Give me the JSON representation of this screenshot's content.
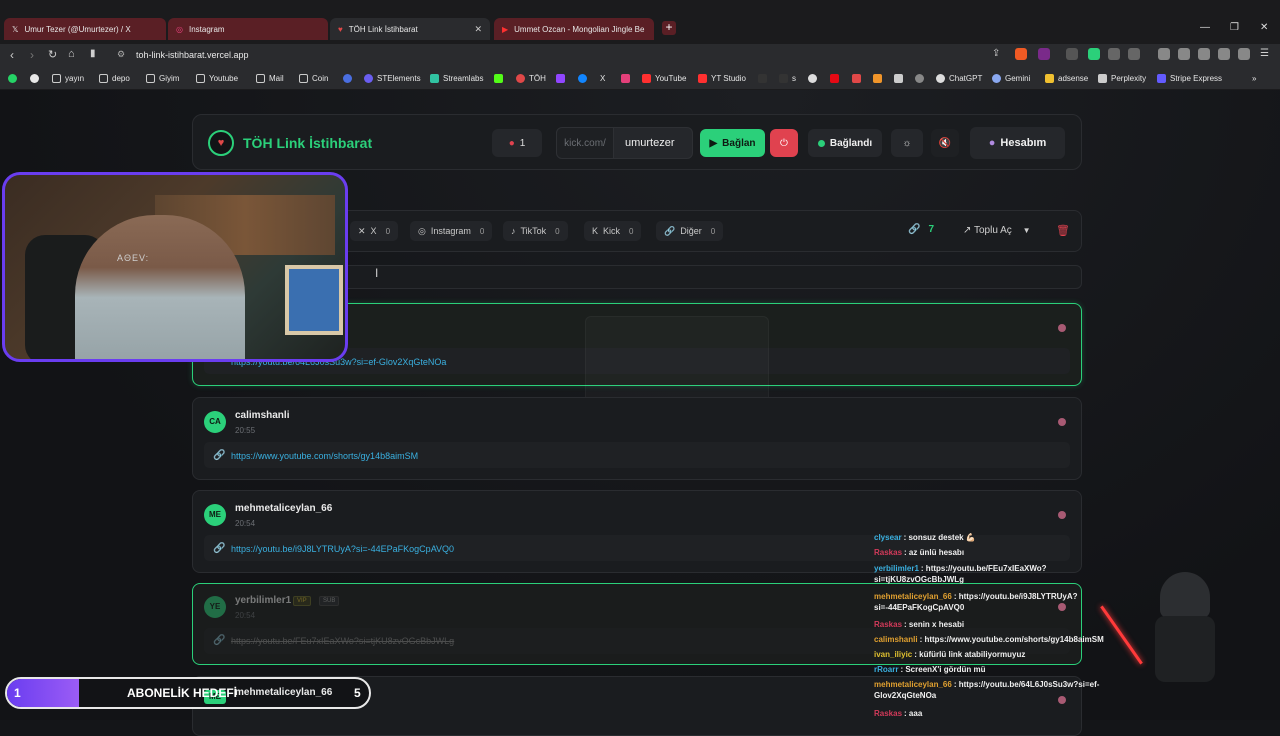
{
  "browser": {
    "tabs": [
      {
        "title": "Umur Tezer (@Umurtezer) / X",
        "icon": "x-icon"
      },
      {
        "title": "Instagram",
        "icon": "instagram-icon"
      },
      {
        "title": "TÖH Link İstihbarat",
        "icon": "toh-icon"
      },
      {
        "title": "Ummet Ozcan - Mongolian Jingle Be",
        "icon": "youtube-icon"
      }
    ],
    "url": "toh-link-istihbarat.vercel.app",
    "bookmarks": [
      "yayın",
      "depo",
      "Giyim",
      "Youtube",
      "Mail",
      "Coin",
      "STElements",
      "Streamlabs",
      "TÖH",
      "X",
      "YouTube",
      "YT Studio",
      "s",
      "ChatGPT",
      "Gemini",
      "adsense",
      "Perplexity",
      "Stripe Express"
    ]
  },
  "header": {
    "title": "TÖH Link İstihbarat",
    "channel_count": "1",
    "kick_prefix": "kick.com/",
    "kick_username": "umurtezer",
    "connect_label": "Bağlan",
    "status_label": "Bağlandı",
    "account_label": "Hesabım"
  },
  "filters": {
    "chips": [
      {
        "label": "X",
        "count": "0"
      },
      {
        "label": "Instagram",
        "count": "0"
      },
      {
        "label": "TikTok",
        "count": "0"
      },
      {
        "label": "Kick",
        "count": "0"
      },
      {
        "label": "Diğer",
        "count": "0"
      }
    ],
    "link_count": "7",
    "bulk_open_label": "Toplu Aç"
  },
  "links": [
    {
      "user": "",
      "initials": "",
      "time": "",
      "url": "https://youtu.be/64L6J0sSu3w?si=ef-Glov2XqGteNOa"
    },
    {
      "user": "calimshanli",
      "initials": "CA",
      "time": "20:55",
      "url": "https://www.youtube.com/shorts/gy14b8aimSM"
    },
    {
      "user": "mehmetaliceylan_66",
      "initials": "ME",
      "time": "20:54",
      "url": "https://youtu.be/i9J8LYTRUyA?si=-44EPaFKogCpAVQ0"
    },
    {
      "user": "yerbilimler1",
      "initials": "YE",
      "time": "20:54",
      "url": "https://youtu.be/FEu7xIEaXWo?si=tjKU8zvOGcBbJWLg",
      "badges": [
        "VIP",
        "SUB"
      ]
    },
    {
      "user": "mehmetaliceylan_66",
      "initials": "ME"
    }
  ],
  "webcam": {
    "shirt_text": "AΘEV:"
  },
  "goal": {
    "start": "1",
    "label": "ABONELİK HEDEFİ",
    "end": "5",
    "progress": 0.2
  },
  "chat": [
    {
      "user": "clysear",
      "color": "#3ab0e0",
      "msg": ": sonsuz destek 💪🏻"
    },
    {
      "user": "Raskas",
      "color": "#d23a5a",
      "msg": ": az ünlü hesabı"
    },
    {
      "user": "yerbilimler1",
      "color": "#3ab0e0",
      "msg": ": https://youtu.be/FEu7xIEaXWo?si=tjKU8zvOGcBbJWLg"
    },
    {
      "user": "mehmetaliceylan_66",
      "color": "#e0a030",
      "msg": ": https://youtu.be/i9J8LYTRUyA?si=-44EPaFKogCpAVQ0"
    },
    {
      "user": "Raskas",
      "color": "#d23a5a",
      "msg": ": senin x hesabi"
    },
    {
      "user": "calimshanli",
      "color": "#e0a030",
      "msg": ": https://www.youtube.com/shorts/gy14b8aimSM"
    },
    {
      "user": "ivan_iliyic",
      "color": "#e0c030",
      "msg": ": küfürlü link atabiliyormuyuz"
    },
    {
      "user": "rRoarr",
      "color": "#3ab0e0",
      "msg": ": ScreenX'i gördün mü"
    },
    {
      "user": "mehmetaliceylan_66",
      "color": "#e0a030",
      "msg": ": https://youtu.be/64L6J0sSu3w?si=ef-Glov2XqGteNOa"
    },
    {
      "user": "Raskas",
      "color": "#d23a5a",
      "msg": ": aaa"
    }
  ]
}
